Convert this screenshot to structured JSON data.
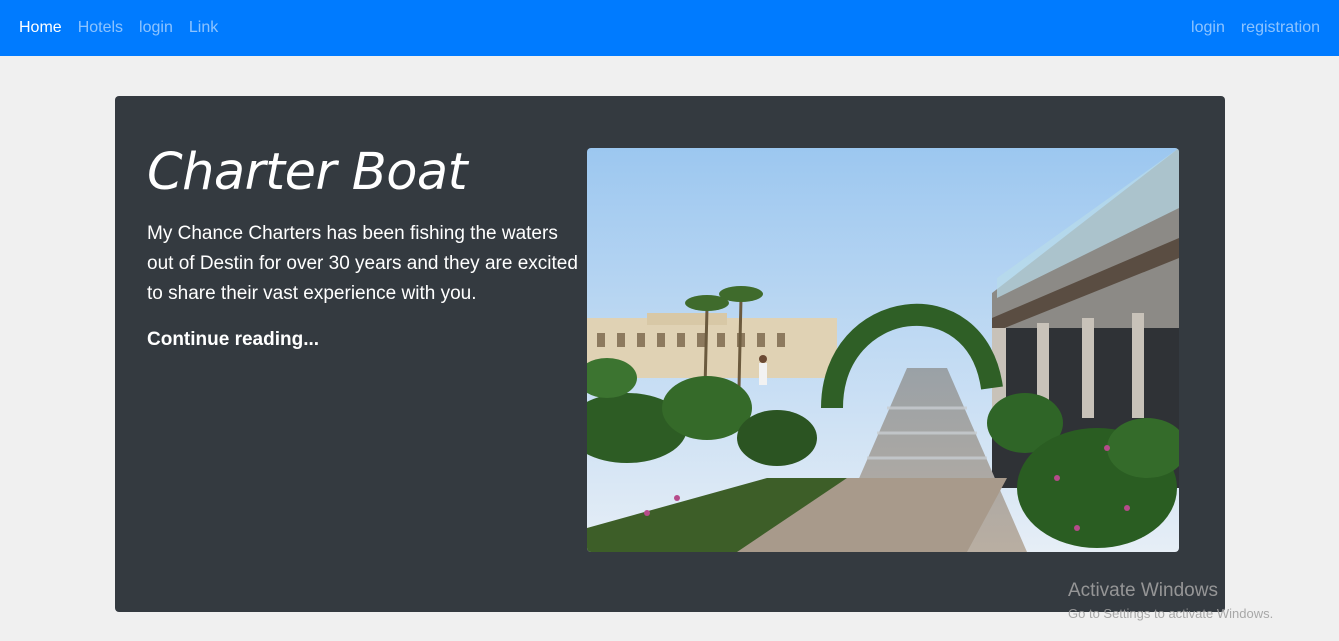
{
  "navbar": {
    "left_links": [
      "Home",
      "Hotels",
      "login",
      "Link"
    ],
    "right_links": [
      "login",
      "registration"
    ],
    "color": "#007bff"
  },
  "jumbotron": {
    "title": "Charter Boat",
    "body": "My Chance Charters has been fishing the waters out of Destin for over 30 years and they are excited to share their vast experience with you.",
    "link_label": "Continue reading...",
    "background": "#343a40"
  },
  "photo": {
    "icon": "resort-photo"
  },
  "watermark": {
    "title": "Activate Windows",
    "subtitle": "Go to Settings to activate Windows."
  }
}
